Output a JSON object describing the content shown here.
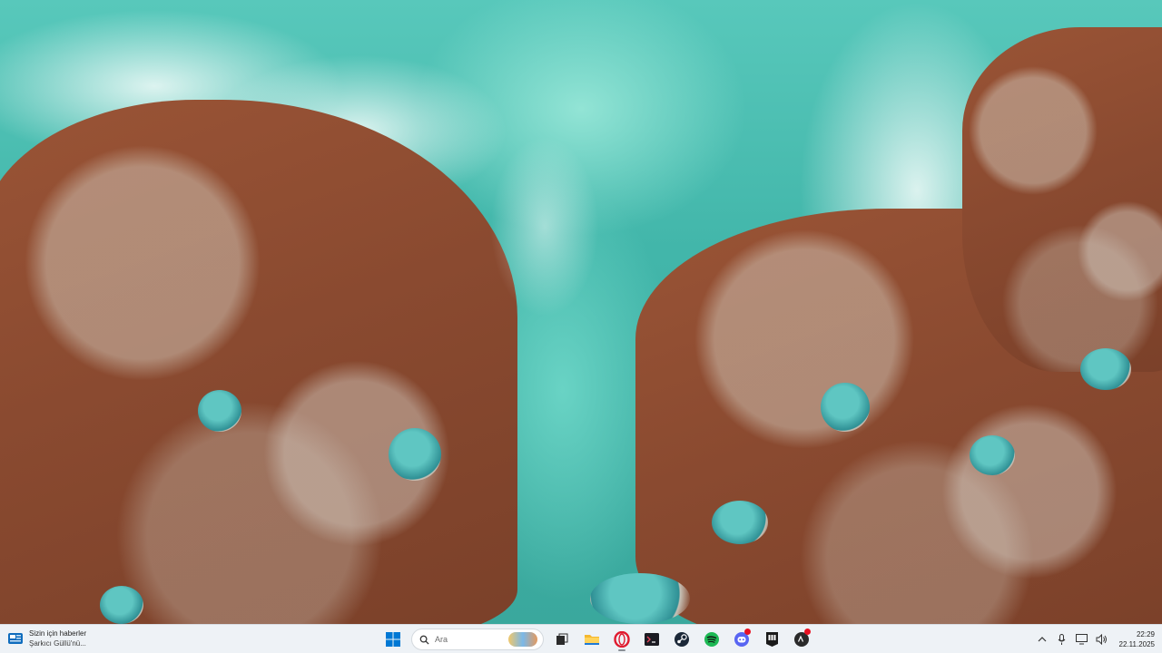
{
  "desktop": {
    "wallpaper": "aerial-coastline-rocks-turquoise-sea"
  },
  "taskbar": {
    "background": "#eef2f6",
    "news": {
      "title": "Sizin için haberler",
      "subtitle": "Şarkıcı Güllü'nü..."
    },
    "search": {
      "placeholder": "Ara"
    },
    "pinned": [
      {
        "name": "start-button",
        "icon": "windows-logo"
      },
      {
        "name": "task-view-button",
        "icon": "task-view"
      },
      {
        "name": "file-explorer-button",
        "icon": "folder"
      },
      {
        "name": "opera-button",
        "icon": "opera"
      },
      {
        "name": "terminal-button",
        "icon": "terminal"
      },
      {
        "name": "steam-button",
        "icon": "steam"
      },
      {
        "name": "spotify-button",
        "icon": "spotify"
      },
      {
        "name": "discord-button",
        "icon": "discord"
      },
      {
        "name": "epic-games-button",
        "icon": "epic-games"
      },
      {
        "name": "ea-app-button",
        "icon": "ea-app"
      }
    ],
    "tray": {
      "time": "22:29",
      "date": "22.11.2025"
    },
    "accent": "#0078d4"
  }
}
